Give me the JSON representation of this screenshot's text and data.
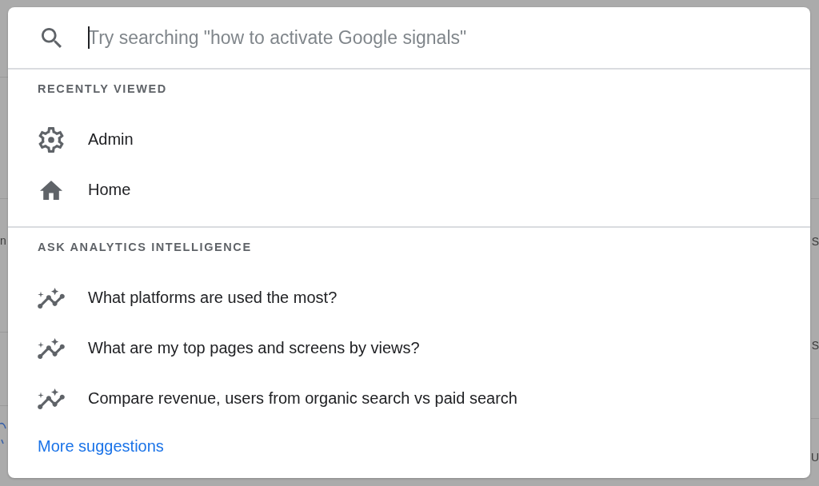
{
  "backdrop": {
    "left_fragments": [
      "n"
    ],
    "right_fragments": [
      "S",
      "S",
      "U"
    ]
  },
  "search": {
    "placeholder": "Try searching \"how to activate Google signals\""
  },
  "sections": [
    {
      "heading": "RECENTLY VIEWED",
      "items": [
        {
          "label": "Admin",
          "kind": "settings"
        },
        {
          "label": "Home",
          "kind": "home"
        }
      ]
    },
    {
      "heading": "ASK ANALYTICS INTELLIGENCE",
      "items": [
        {
          "label": "What platforms are used the most?",
          "kind": "insight"
        },
        {
          "label": "What are my top pages and screens by views?",
          "kind": "insight"
        },
        {
          "label": "Compare revenue, users from organic search vs paid search",
          "kind": "insight"
        }
      ],
      "link": "More suggestions"
    }
  ]
}
